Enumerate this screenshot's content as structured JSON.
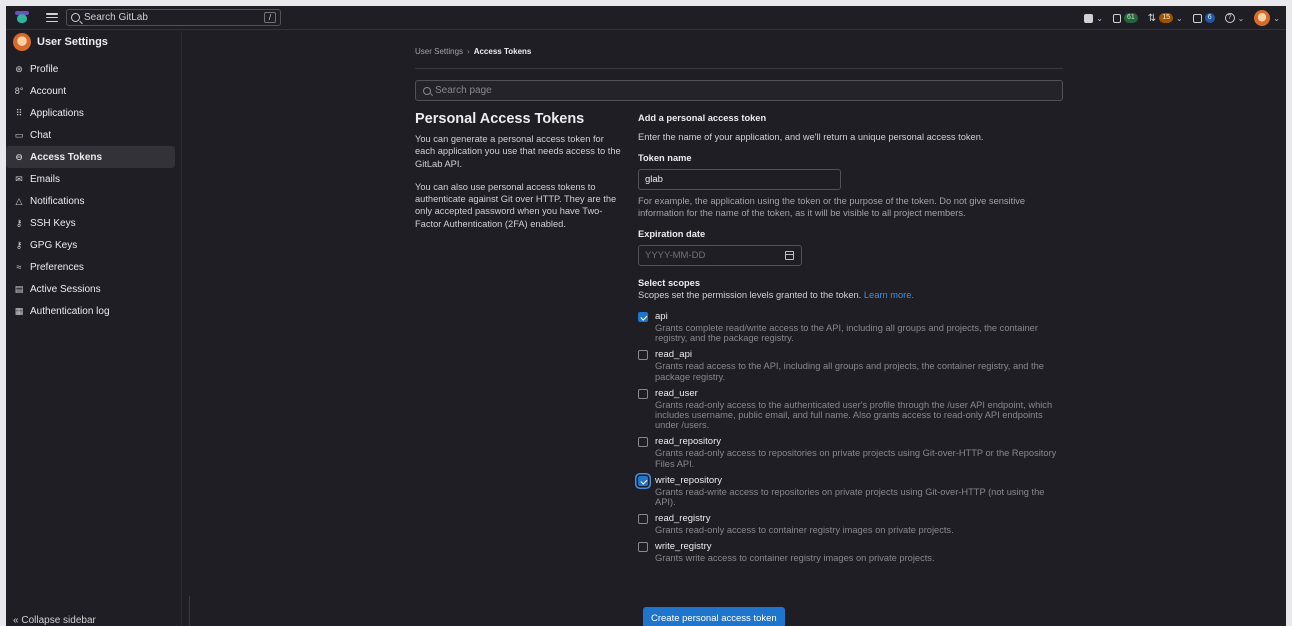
{
  "topbar": {
    "search_placeholder": "Search GitLab",
    "search_shortcut": "/",
    "issues_count": "61",
    "merge_requests_count": "15",
    "todos_count": "6",
    "icons": [
      "plus-square-icon",
      "issues-icon",
      "merge-request-icon",
      "todo-icon",
      "help-icon",
      "avatar"
    ]
  },
  "sidebar": {
    "title": "User Settings",
    "items": [
      {
        "label": "Profile",
        "icon": "profile-icon"
      },
      {
        "label": "Account",
        "icon": "account-icon"
      },
      {
        "label": "Applications",
        "icon": "applications-icon"
      },
      {
        "label": "Chat",
        "icon": "chat-icon"
      },
      {
        "label": "Access Tokens",
        "icon": "token-icon",
        "active": true
      },
      {
        "label": "Emails",
        "icon": "mail-icon"
      },
      {
        "label": "Notifications",
        "icon": "bell-icon"
      },
      {
        "label": "SSH Keys",
        "icon": "key-icon"
      },
      {
        "label": "GPG Keys",
        "icon": "key-icon"
      },
      {
        "label": "Preferences",
        "icon": "preferences-icon"
      },
      {
        "label": "Active Sessions",
        "icon": "monitor-icon"
      },
      {
        "label": "Authentication log",
        "icon": "log-icon"
      }
    ],
    "collapse_label": "Collapse sidebar"
  },
  "breadcrumb": {
    "parent": "User Settings",
    "current": "Access Tokens"
  },
  "page_search_placeholder": "Search page",
  "intro": {
    "title": "Personal Access Tokens",
    "p1": "You can generate a personal access token for each application you use that needs access to the GitLab API.",
    "p2": "You can also use personal access tokens to authenticate against Git over HTTP. They are the only accepted password when you have Two-Factor Authentication (2FA) enabled."
  },
  "form": {
    "heading": "Add a personal access token",
    "subheading": "Enter the name of your application, and we'll return a unique personal access token.",
    "token_name_label": "Token name",
    "token_name_value": "glab",
    "token_name_help": "For example, the application using the token or the purpose of the token. Do not give sensitive information for the name of the token, as it will be visible to all project members.",
    "expiration_label": "Expiration date",
    "expiration_placeholder": "YYYY-MM-DD",
    "scopes_label": "Select scopes",
    "scopes_help": "Scopes set the permission levels granted to the token.",
    "learn_more": "Learn more.",
    "submit_label": "Create personal access token"
  },
  "scopes": [
    {
      "name": "api",
      "checked": true,
      "desc": "Grants complete read/write access to the API, including all groups and projects, the container registry, and the package registry."
    },
    {
      "name": "read_api",
      "checked": false,
      "desc": "Grants read access to the API, including all groups and projects, the container registry, and the package registry."
    },
    {
      "name": "read_user",
      "checked": false,
      "desc": "Grants read-only access to the authenticated user's profile through the /user API endpoint, which includes username, public email, and full name. Also grants access to read-only API endpoints under /users."
    },
    {
      "name": "read_repository",
      "checked": false,
      "desc": "Grants read-only access to repositories on private projects using Git-over-HTTP or the Repository Files API."
    },
    {
      "name": "write_repository",
      "checked": true,
      "focused": true,
      "desc": "Grants read-write access to repositories on private projects using Git-over-HTTP (not using the API)."
    },
    {
      "name": "read_registry",
      "checked": false,
      "desc": "Grants read-only access to container registry images on private projects."
    },
    {
      "name": "write_registry",
      "checked": false,
      "desc": "Grants write access to container registry images on private projects."
    }
  ]
}
